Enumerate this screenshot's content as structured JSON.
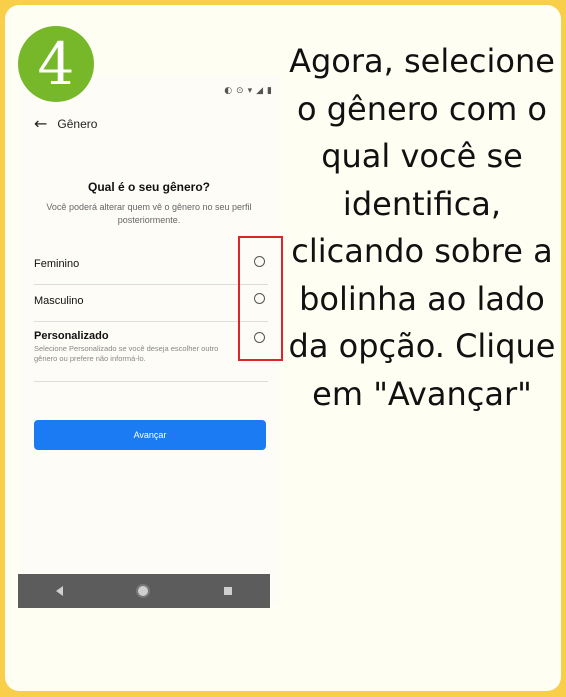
{
  "step": {
    "number": "4"
  },
  "phone": {
    "status_icons": [
      "wifi-icon",
      "data-icon",
      "signal-icon",
      "battery-icon"
    ],
    "header": {
      "title": "Gênero"
    },
    "question": "Qual é o seu gênero?",
    "subtitle": "Você poderá alterar quem vê o gênero no seu perfil posteriormente.",
    "options": [
      {
        "label": "Feminino"
      },
      {
        "label": "Masculino"
      },
      {
        "label": "Personalizado",
        "description": "Selecione Personalizado se você deseja escolher outro gênero ou prefere não informá-lo."
      }
    ],
    "next_button": "Avançar"
  },
  "instructions": "Agora, selecione o gênero com o qual você se identifica, clicando sobre a bolinha ao lado da opção. Clique em \"Avançar\"",
  "colors": {
    "background": "#f9cf4a",
    "badge": "#76b82a",
    "highlight": "#e0242a",
    "button": "#1a7bf2"
  }
}
